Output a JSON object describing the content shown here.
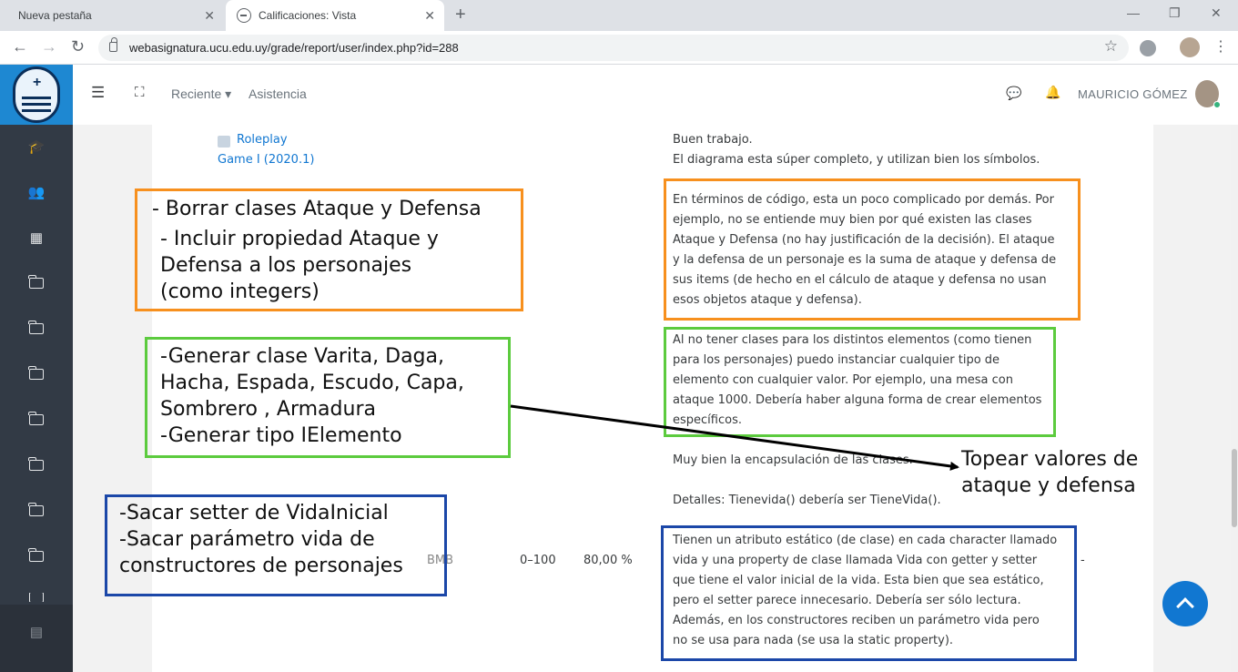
{
  "browser": {
    "tabs": [
      {
        "label": "Nueva pestaña"
      },
      {
        "label": "Calificaciones: Vista"
      }
    ],
    "new_tab": "+",
    "close_glyph": "✕",
    "url": "webasignatura.ucu.edu.uy/grade/report/user/index.php?id=288"
  },
  "navbar": {
    "recent": "Reciente ▾",
    "attendance": "Asistencia",
    "user_name": "MAURICIO GÓMEZ"
  },
  "report": {
    "item_link_line1": "Roleplay",
    "item_link_line2": "Game I (2020.1)",
    "grade_letter": "BMB",
    "range": "0–100",
    "percentage": "80,00 %",
    "dash": "-",
    "feedback": [
      "Buen trabajo.",
      "El diagrama esta súper completo, y utilizan bien los símbolos.",
      "En términos de código, esta un poco complicado por demás. Por",
      "ejemplo, no se entiende muy bien por qué existen las clases",
      "Ataque y Defensa (no hay justificación de la decisión). El ataque",
      "y la defensa de un personaje es la suma de ataque y defensa de",
      "sus items (de hecho en el cálculo de ataque y defensa no usan",
      "esos objetos ataque y defensa).",
      "Al no tener clases para los distintos elementos (como tienen",
      "para los personajes) puedo instanciar cualquier tipo de",
      "elemento con cualquier valor. Por ejemplo, una mesa con",
      "ataque 1000. Debería haber alguna forma de crear elementos",
      "específicos.",
      "Muy bien la encapsulación de las clases.",
      "Detalles: Tienevida() debería ser TieneVida().",
      "Tienen un atributo estático (de clase) en cada character llamado",
      "vida y una property de clase llamada Vida con getter y setter",
      "que tiene el valor inicial de la vida. Esta bien que sea estático,",
      "pero el setter parece innecesario. Debería ser sólo lectura.",
      "Además, en los constructores reciben un parámetro vida pero",
      "no se usa para nada (se usa la static property)."
    ]
  },
  "annotations": {
    "orange": [
      "- Borrar clases Ataque y Defensa",
      "- Incluir propiedad Ataque y",
      "Defensa a los personajes",
      "(como integers)"
    ],
    "green": [
      "-Generar clase Varita, Daga,",
      "Hacha, Espada, Escudo, Capa,",
      "Sombrero  , Armadura",
      "-Generar tipo IElemento"
    ],
    "blue": [
      "-Sacar setter de VidaInicial",
      "-Sacar parámetro vida de",
      "constructores de personajes"
    ],
    "arrow_note": [
      "Topear valores de",
      "ataque y defensa"
    ]
  },
  "colors": {
    "orange": "#f7901e",
    "green": "#5ccb3e",
    "blue": "#1b47a8",
    "link": "#1177d1"
  }
}
